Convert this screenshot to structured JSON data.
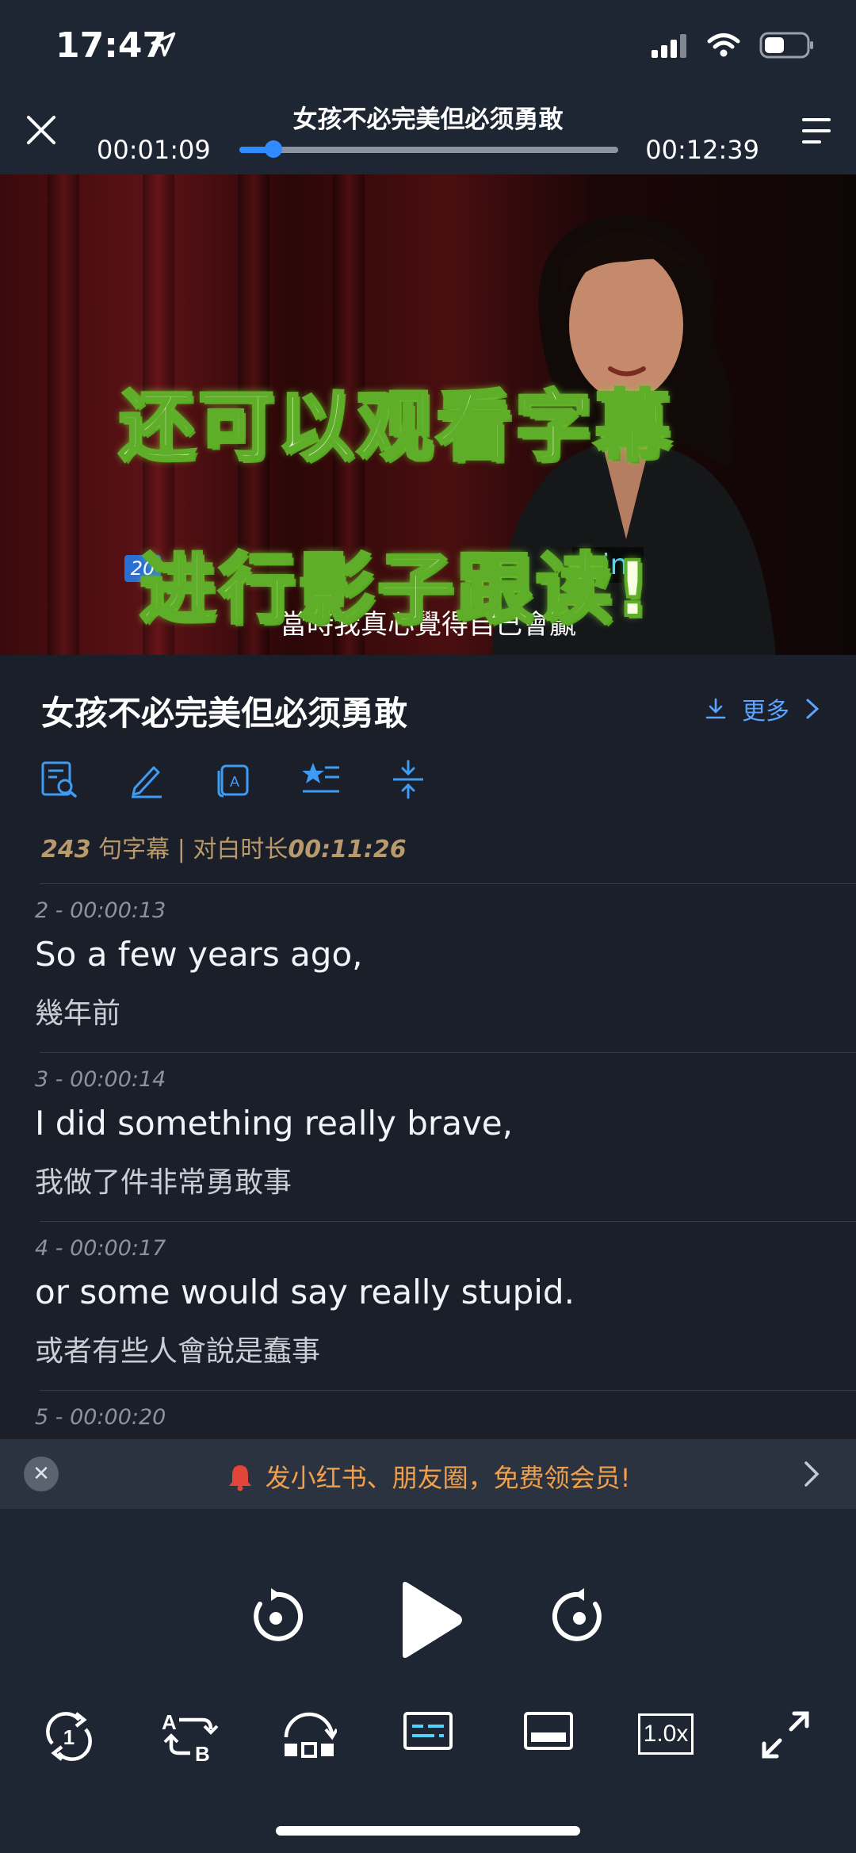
{
  "status": {
    "time": "17:47"
  },
  "player": {
    "title": "女孩不必完美但必须勇敢",
    "elapsed": "00:01:09",
    "duration": "00:12:39",
    "progress": 0.091
  },
  "video": {
    "overlay_line1": "还可以观看字幕",
    "overlay_line2": "进行影子跟读!",
    "subtitle_index": "20",
    "subtitle_en": "win.",
    "subtitle_zh": "當時我真心覺得自己會贏"
  },
  "info": {
    "title": "女孩不必完美但必须勇敢",
    "more_label": "更多",
    "sentence_count": "243",
    "sentence_label": "句字幕",
    "separator": "|",
    "dialog_label": "对白时长",
    "dialog_duration": "00:11:26"
  },
  "subtitles": [
    {
      "meta": "2  -  00:00:13",
      "en": "So a few years ago,",
      "zh": "幾年前"
    },
    {
      "meta": "3  -  00:00:14",
      "en": "I did something really brave,",
      "zh": "我做了件非常勇敢事"
    },
    {
      "meta": "4  -  00:00:17",
      "en": "or some would say really stupid.",
      "zh": "或者有些人會說是蠢事"
    },
    {
      "meta": "5  -  00:00:20",
      "en": "",
      "zh": ""
    }
  ],
  "banner": {
    "text": "发小红书、朋友圈，免费领会员!"
  },
  "bottom": {
    "speed_label": "1.0x",
    "loop_label": "1",
    "ab_label_a": "A",
    "ab_label_b": "B"
  },
  "colors": {
    "accent": "#2f8bff",
    "banner_text": "#f0a04a",
    "stats": "#b89a6d"
  }
}
